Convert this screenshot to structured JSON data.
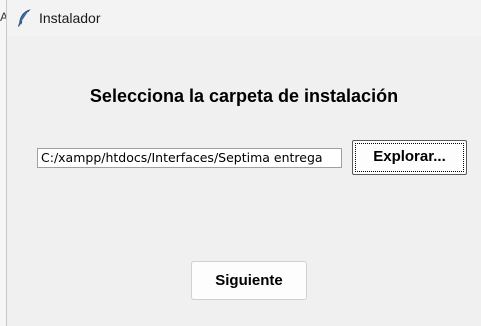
{
  "backdrop": {
    "edge_text": "A"
  },
  "window": {
    "title": "Instalador",
    "icon": "feather-icon"
  },
  "main": {
    "heading": "Selecciona la carpeta de instalación",
    "path_value": "C:/xampp/htdocs/Interfaces/Septima entrega",
    "browse_label": "Explorar...",
    "next_label": "Siguiente"
  },
  "colors": {
    "window_bg": "#f0f0f0",
    "button_bg": "#fdfdfd",
    "text": "#000000"
  }
}
